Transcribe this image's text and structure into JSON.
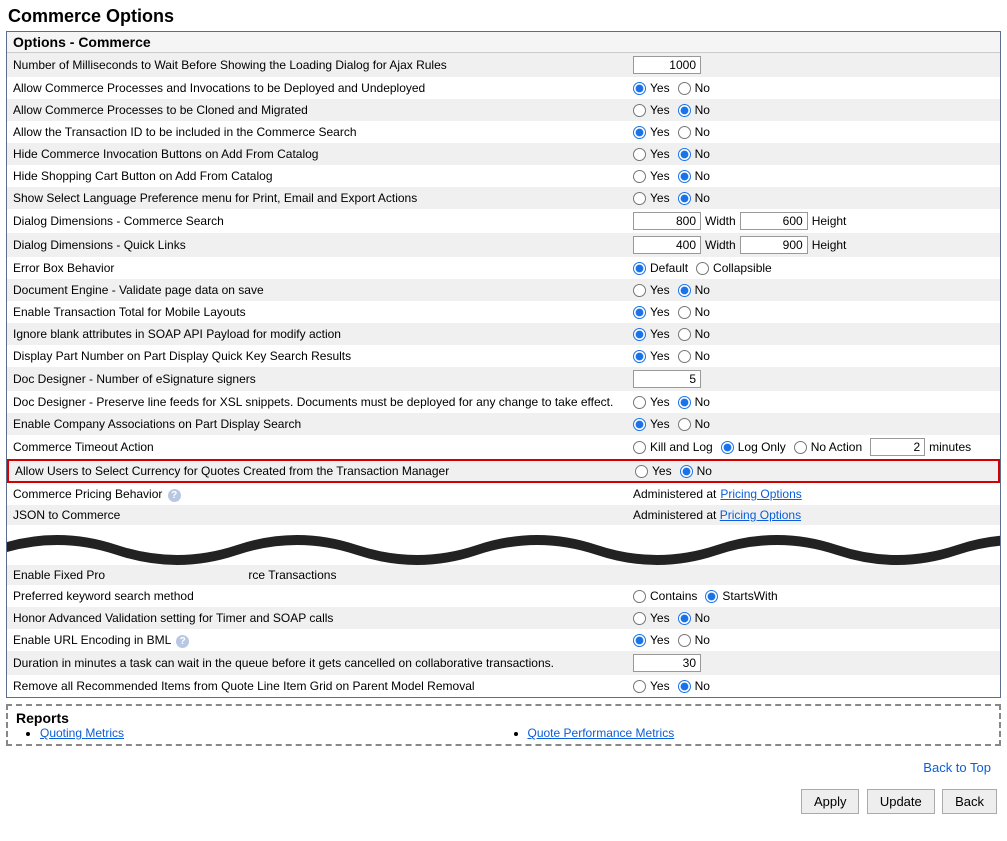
{
  "page_title": "Commerce Options",
  "section_header": "Options - Commerce",
  "rows": {
    "ms_wait": {
      "label": "Number of Milliseconds to Wait Before Showing the Loading Dialog for Ajax Rules",
      "value": "1000"
    },
    "deploy": {
      "label": "Allow Commerce Processes and Invocations to be Deployed and Undeployed",
      "yes": "Yes",
      "no": "No"
    },
    "clone": {
      "label": "Allow Commerce Processes to be Cloned and Migrated",
      "yes": "Yes",
      "no": "No"
    },
    "txnid": {
      "label": "Allow the Transaction ID to be included in the Commerce Search",
      "yes": "Yes",
      "no": "No"
    },
    "hide_inv": {
      "label": "Hide Commerce Invocation Buttons on Add From Catalog",
      "yes": "Yes",
      "no": "No"
    },
    "hide_cart": {
      "label": "Hide Shopping Cart Button on Add From Catalog",
      "yes": "Yes",
      "no": "No"
    },
    "lang_pref": {
      "label": "Show Select Language Preference menu for Print, Email and Export Actions",
      "yes": "Yes",
      "no": "No"
    },
    "dim_search": {
      "label": "Dialog Dimensions - Commerce Search",
      "w": "800",
      "h": "600",
      "width": "Width",
      "height": "Height"
    },
    "dim_quick": {
      "label": "Dialog Dimensions - Quick Links",
      "w": "400",
      "h": "900",
      "width": "Width",
      "height": "Height"
    },
    "err_box": {
      "label": "Error Box Behavior",
      "default": "Default",
      "coll": "Collapsible"
    },
    "doc_engine": {
      "label": "Document Engine - Validate page data on save",
      "yes": "Yes",
      "no": "No"
    },
    "txn_total": {
      "label": "Enable Transaction Total for Mobile Layouts",
      "yes": "Yes",
      "no": "No"
    },
    "soap_blank": {
      "label": "Ignore blank attributes in SOAP API Payload for modify action",
      "yes": "Yes",
      "no": "No"
    },
    "part_num": {
      "label": "Display Part Number on Part Display Quick Key Search Results",
      "yes": "Yes",
      "no": "No"
    },
    "esig": {
      "label": "Doc Designer - Number of eSignature signers",
      "value": "5"
    },
    "linefeed": {
      "label": "Doc Designer - Preserve line feeds for XSL snippets. Documents must be deployed for any change to take effect.",
      "yes": "Yes",
      "no": "No"
    },
    "company_assoc": {
      "label": "Enable Company Associations on Part Display Search",
      "yes": "Yes",
      "no": "No"
    },
    "timeout": {
      "label": "Commerce Timeout Action",
      "kill": "Kill and Log",
      "log": "Log Only",
      "none": "No Action",
      "value": "2",
      "unit": "minutes"
    },
    "currency": {
      "label": "Allow Users to Select Currency for Quotes Created from the Transaction Manager",
      "yes": "Yes",
      "no": "No"
    },
    "pricing": {
      "label": "Commerce Pricing Behavior",
      "admin": "Administered at ",
      "link": "Pricing Options"
    },
    "json": {
      "label_partial": "JSON to Commerce",
      "admin": "Administered at ",
      "link": "Pricing Options"
    },
    "fixed": {
      "label_partial": "Enable Fixed Pro",
      "label_partial2": "rce Transactions"
    },
    "keyword": {
      "label": "Preferred keyword search method",
      "contains": "Contains",
      "starts": "StartsWith"
    },
    "honor": {
      "label": "Honor Advanced Validation setting for Timer and SOAP calls",
      "yes": "Yes",
      "no": "No"
    },
    "url_enc": {
      "label": "Enable URL Encoding in BML",
      "yes": "Yes",
      "no": "No"
    },
    "duration": {
      "label": "Duration in minutes a task can wait in the queue before it gets cancelled on collaborative transactions.",
      "value": "30"
    },
    "remove_rec": {
      "label": "Remove all Recommended Items from Quote Line Item Grid on Parent Model Removal",
      "yes": "Yes",
      "no": "No"
    }
  },
  "reports": {
    "title": "Reports",
    "quoting": "Quoting Metrics",
    "perf": "Quote Performance Metrics"
  },
  "footer": {
    "back_top": "Back to Top",
    "apply": "Apply",
    "update": "Update",
    "back": "Back"
  }
}
